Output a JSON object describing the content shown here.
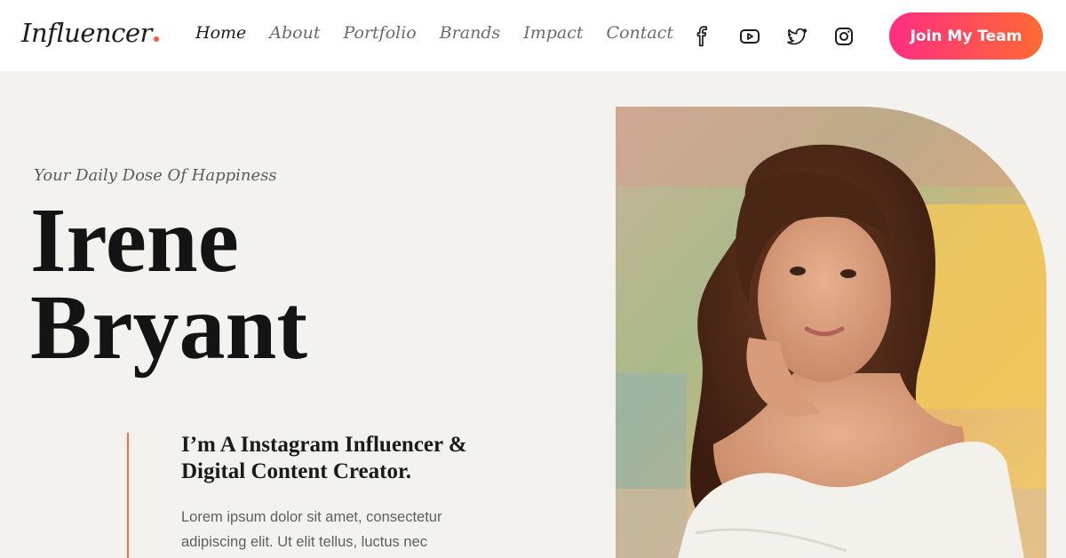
{
  "header": {
    "logo_text": "Influencer",
    "nav": [
      {
        "label": "Home",
        "active": true
      },
      {
        "label": "About",
        "active": false
      },
      {
        "label": "Portfolio",
        "active": false
      },
      {
        "label": "Brands",
        "active": false
      },
      {
        "label": "Impact",
        "active": false
      },
      {
        "label": "Contact",
        "active": false
      }
    ],
    "socials": [
      "facebook-icon",
      "youtube-icon",
      "twitter-icon",
      "instagram-icon"
    ],
    "cta_label": "Join My Team"
  },
  "hero": {
    "tagline": "Your Daily Dose Of Happiness",
    "first_name": "Irene",
    "last_name": "Bryant",
    "subtitle": "I’m A Instagram Influencer & Digital Content Creator.",
    "description": "Lorem ipsum dolor sit amet, consectetur adipiscing elit. Ut elit tellus, luctus nec"
  },
  "colors": {
    "accent": "#ff5a3c",
    "cta_gradient_start": "#ff2d83",
    "cta_gradient_end": "#ff6a33",
    "hero_background": "#f4f2ee"
  }
}
